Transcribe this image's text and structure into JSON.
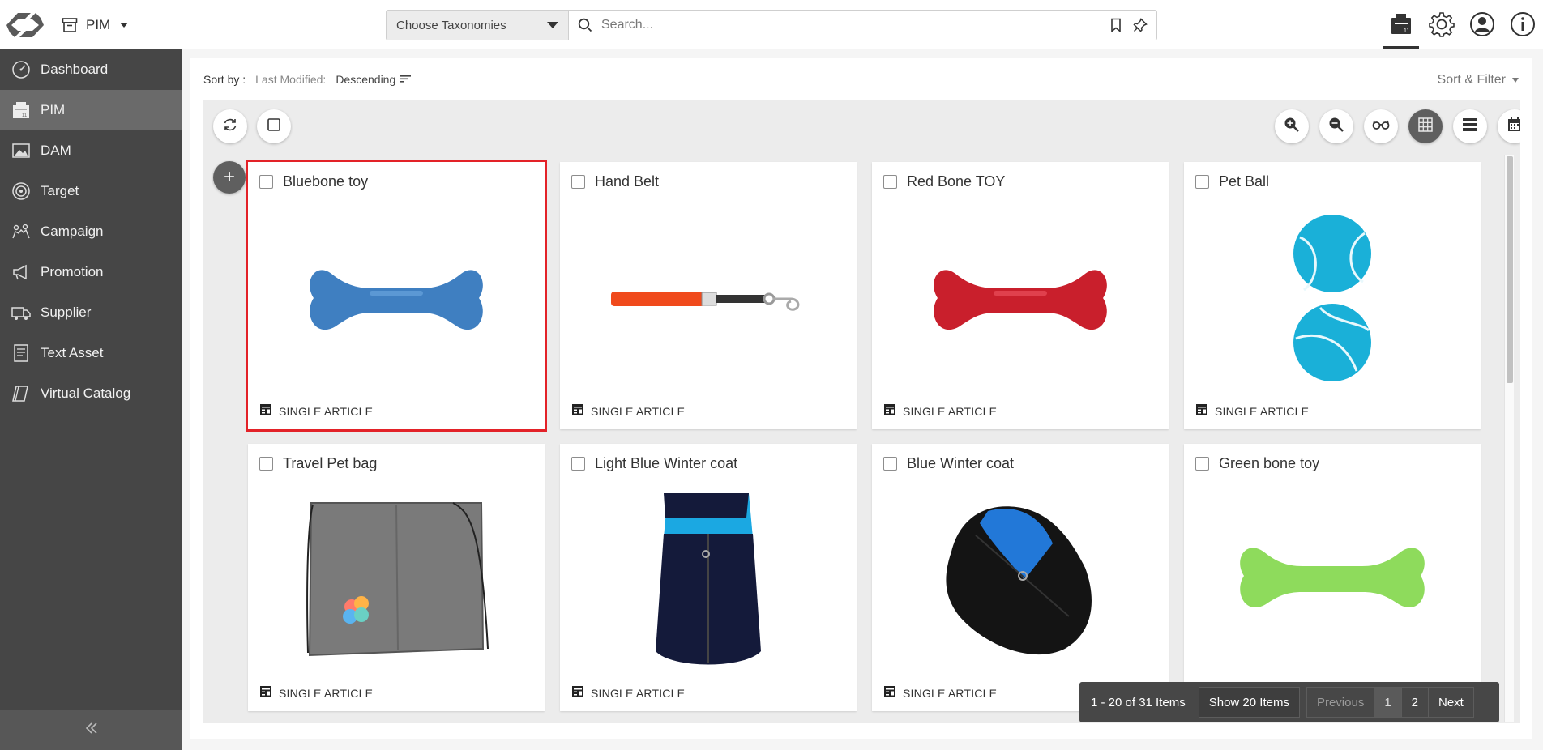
{
  "topbar": {
    "module_label": "PIM",
    "taxonomy_label": "Choose Taxonomies",
    "search_placeholder": "Search...",
    "icons": [
      "logo-icon",
      "archive-icon",
      "bookmark-icon",
      "pin-icon",
      "calendar-icon",
      "gear-icon",
      "user-icon",
      "info-icon"
    ]
  },
  "sidebar": {
    "items": [
      {
        "label": "Dashboard",
        "icon": "dashboard-icon"
      },
      {
        "label": "PIM",
        "icon": "pim-icon",
        "active": true
      },
      {
        "label": "DAM",
        "icon": "dam-icon"
      },
      {
        "label": "Target",
        "icon": "target-icon"
      },
      {
        "label": "Campaign",
        "icon": "campaign-icon"
      },
      {
        "label": "Promotion",
        "icon": "megaphone-icon"
      },
      {
        "label": "Supplier",
        "icon": "truck-icon"
      },
      {
        "label": "Text Asset",
        "icon": "document-icon"
      },
      {
        "label": "Virtual Catalog",
        "icon": "catalog-icon"
      }
    ],
    "collapse_icon": "double-chevron-left-icon"
  },
  "sort": {
    "label": "Sort by :",
    "key": "Last Modified:",
    "direction": "Descending",
    "filter_label": "Sort & Filter"
  },
  "toolbar": {
    "left": [
      "refresh-icon",
      "select-all-icon"
    ],
    "right": [
      "zoom-in-icon",
      "zoom-out-icon",
      "preview-glasses-icon",
      "grid-view-icon",
      "list-view-icon",
      "calendar-view-icon"
    ],
    "add_label": "+"
  },
  "products": [
    {
      "title": "Bluebone toy",
      "type": "SINGLE ARTICLE",
      "image": "blue-bone-toy",
      "color": "#3f7fc1",
      "selected": true
    },
    {
      "title": "Hand Belt",
      "type": "SINGLE ARTICLE",
      "image": "leash",
      "color": "#f04a1c"
    },
    {
      "title": "Red Bone TOY",
      "type": "SINGLE ARTICLE",
      "image": "red-bone-toy",
      "color": "#c91f2c"
    },
    {
      "title": "Pet Ball",
      "type": "SINGLE ARTICLE",
      "image": "tennis-balls",
      "color": "#1ab0d8"
    },
    {
      "title": "Travel Pet bag",
      "type": "SINGLE ARTICLE",
      "image": "drawstring-bag",
      "color": "#777777"
    },
    {
      "title": "Light Blue Winter coat",
      "type": "SINGLE ARTICLE",
      "image": "winter-coat-navy",
      "color": "#1ba8e2"
    },
    {
      "title": "Blue Winter coat",
      "type": "SINGLE ARTICLE",
      "image": "winter-coat-black",
      "color": "#2278d8"
    },
    {
      "title": "Green bone toy",
      "type": "SINGLE ARTICLE",
      "image": "green-bone-toy",
      "color": "#8edb5c"
    }
  ],
  "pagination": {
    "info": "1 - 20 of 31 Items",
    "show": "Show 20 Items",
    "previous": "Previous",
    "pages": [
      "1",
      "2"
    ],
    "current_page": "1",
    "next": "Next"
  }
}
